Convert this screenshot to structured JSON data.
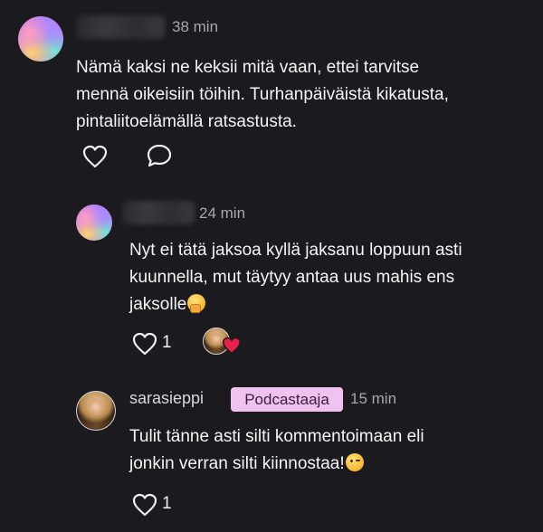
{
  "comments": [
    {
      "author": "",
      "time": "38 min",
      "text": "Nämä kaksi ne keksii mitä vaan, ettei tarvitse\nmennä oikeisiin töihin. Turhanpäiväistä kikatusta,\npintaliitoelämällä ratsastusta.",
      "actions": {
        "like_icon": "heart-outline-icon",
        "reply_icon": "speech-bubble-icon"
      }
    },
    {
      "author": "",
      "time": "24 min",
      "text": "Nyt ei tätä jaksoa kyllä jaksanu loppuun asti\nkuunnella, mut täytyy antaa uus mahis ens\njaksolle",
      "emoji": "hand-over-mouth-emoji",
      "like_count": "1",
      "reaction_icon": "red-heart-icon"
    },
    {
      "author": "sarasieppi",
      "badge": "Podcastaaja",
      "time": "15 min",
      "text": "Tulit tänne asti silti kommentoimaan eli\njonkin verran silti kiinnostaa!",
      "emoji": "winking-face-emoji",
      "like_count": "1"
    }
  ],
  "colors": {
    "background": "#1b1a1f",
    "badge_bg": "#f0c2f0",
    "muted_text": "#a8a7ad",
    "heart": "#e8204a"
  }
}
